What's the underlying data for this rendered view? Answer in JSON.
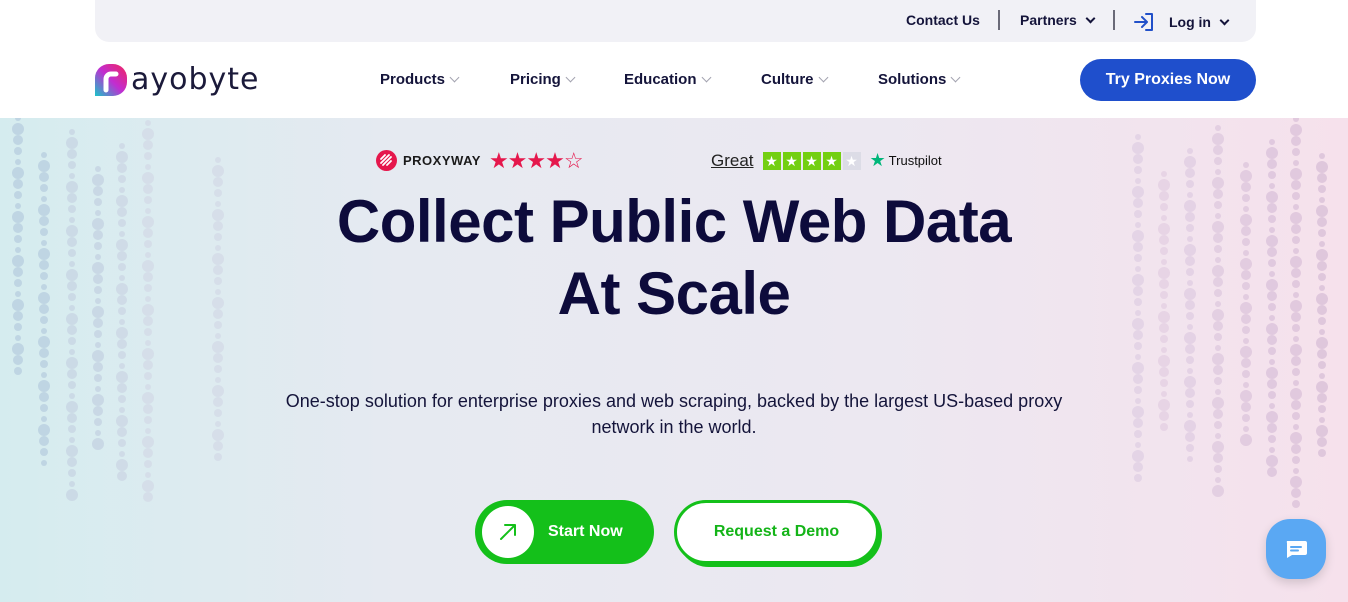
{
  "topbar": {
    "contact": "Contact Us",
    "partners": "Partners",
    "login": "Log in"
  },
  "brand": {
    "name": "ayobyte"
  },
  "nav": {
    "items": [
      {
        "label": "Products"
      },
      {
        "label": "Pricing"
      },
      {
        "label": "Education"
      },
      {
        "label": "Culture"
      },
      {
        "label": "Solutions"
      }
    ],
    "cta": "Try Proxies Now"
  },
  "ratings": {
    "proxyway": {
      "name": "PROXYWAY",
      "stars": "★★★★☆",
      "rating": 4
    },
    "trustpilot": {
      "label": "Great",
      "brand": "Trustpilot",
      "rating": 4
    }
  },
  "hero": {
    "headline_line1": "Collect Public Web Data",
    "headline_line2": "At Scale",
    "subtitle": "One-stop solution for enterprise proxies and web scraping, backed by the largest US-based proxy network in the world.",
    "primary_cta": "Start Now",
    "secondary_cta": "Request a Demo"
  },
  "colors": {
    "primary_blue": "#1f4fcc",
    "accent_green": "#14c01a",
    "headline": "#0d0b3b",
    "proxyway_red": "#e5174c",
    "trustpilot_green": "#73cf11"
  },
  "icons": {
    "login": "login-arrow-icon",
    "start": "arrow-up-right-icon",
    "chat": "chat-bubble-icon"
  }
}
